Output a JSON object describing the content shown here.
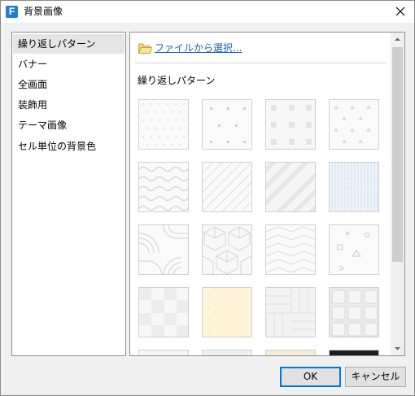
{
  "window": {
    "title": "背景画像",
    "app_icon_letter": "F",
    "close_icon": "close-icon"
  },
  "sidebar": {
    "items": [
      {
        "label": "繰り返しパターン",
        "selected": true
      },
      {
        "label": "バナー",
        "selected": false
      },
      {
        "label": "全画面",
        "selected": false
      },
      {
        "label": "装飾用",
        "selected": false
      },
      {
        "label": "テーマ画像",
        "selected": false
      },
      {
        "label": "セル単位の背景色",
        "selected": false
      }
    ]
  },
  "main": {
    "file_link_label": "ファイルから選択...",
    "file_link_icon": "folder-icon",
    "section_title": "繰り返しパターン",
    "patterns": [
      {
        "name": "pattern-diagonal-dots"
      },
      {
        "name": "pattern-sparse-dots"
      },
      {
        "name": "pattern-squares"
      },
      {
        "name": "pattern-triangles"
      },
      {
        "name": "pattern-waves"
      },
      {
        "name": "pattern-diagonal-lines"
      },
      {
        "name": "pattern-wide-stripes"
      },
      {
        "name": "pattern-vertical-lines-blue"
      },
      {
        "name": "pattern-arcs"
      },
      {
        "name": "pattern-cubes"
      },
      {
        "name": "pattern-chevrons"
      },
      {
        "name": "pattern-shapes"
      },
      {
        "name": "pattern-checker"
      },
      {
        "name": "pattern-yellow-grid"
      },
      {
        "name": "pattern-basketweave"
      },
      {
        "name": "pattern-tiles"
      },
      {
        "name": "pattern-partial-1"
      },
      {
        "name": "pattern-partial-2"
      },
      {
        "name": "pattern-partial-3"
      },
      {
        "name": "pattern-partial-dark"
      }
    ]
  },
  "buttons": {
    "ok_label": "OK",
    "cancel_label": "キャンセル"
  },
  "colors": {
    "link": "#1a5fb4",
    "accent": "#0078d7",
    "selection": "#e5e5e5"
  }
}
